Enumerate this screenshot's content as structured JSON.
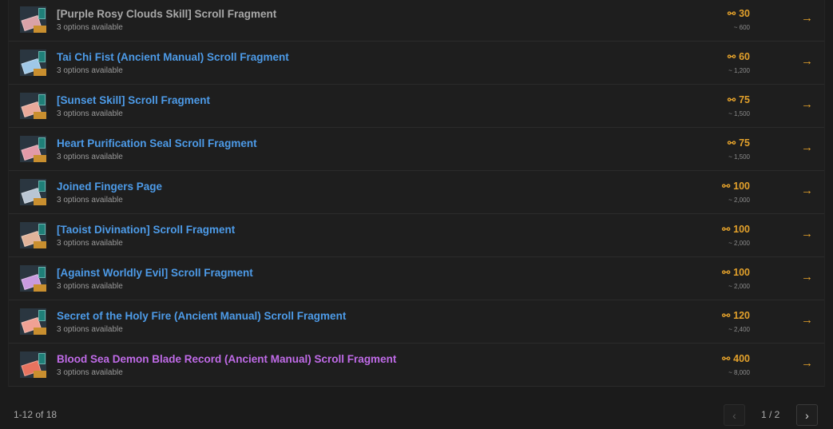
{
  "items": [
    {
      "title": "[Purple Rosy Clouds Skill] Scroll Fragment",
      "subtitle": "3 options available",
      "price": "30",
      "approx": "~ 600",
      "title_color": "#a8a8a8",
      "paper_color": "#d9a2a8"
    },
    {
      "title": "Tai Chi Fist (Ancient Manual) Scroll Fragment",
      "subtitle": "3 options available",
      "price": "60",
      "approx": "~ 1,200",
      "title_color": "#4d9be8",
      "paper_color": "#9fc8e8"
    },
    {
      "title": "[Sunset Skill] Scroll Fragment",
      "subtitle": "3 options available",
      "price": "75",
      "approx": "~ 1,500",
      "title_color": "#4d9be8",
      "paper_color": "#e8a99a"
    },
    {
      "title": "Heart Purification Seal Scroll Fragment",
      "subtitle": "3 options available",
      "price": "75",
      "approx": "~ 1,500",
      "title_color": "#4d9be8",
      "paper_color": "#e29aa8"
    },
    {
      "title": "Joined Fingers Page",
      "subtitle": "3 options available",
      "price": "100",
      "approx": "~ 2,000",
      "title_color": "#4d9be8",
      "paper_color": "#b9c6d4"
    },
    {
      "title": "[Taoist Divination] Scroll Fragment",
      "subtitle": "3 options available",
      "price": "100",
      "approx": "~ 2,000",
      "title_color": "#4d9be8",
      "paper_color": "#e0b39a"
    },
    {
      "title": "[Against Worldly Evil] Scroll Fragment",
      "subtitle": "3 options available",
      "price": "100",
      "approx": "~ 2,000",
      "title_color": "#4d9be8",
      "paper_color": "#c89adf"
    },
    {
      "title": "Secret of the Holy Fire (Ancient Manual) Scroll Fragment",
      "subtitle": "3 options available",
      "price": "120",
      "approx": "~ 2,400",
      "title_color": "#4d9be8",
      "paper_color": "#f0a194"
    },
    {
      "title": "Blood Sea Demon Blade Record (Ancient Manual) Scroll Fragment",
      "subtitle": "3 options available",
      "price": "400",
      "approx": "~ 8,000",
      "title_color": "#c06be8",
      "paper_color": "#e7735f"
    }
  ],
  "icons": {
    "coin": "coin-icon",
    "arrow": "arrow-right-icon",
    "prev": "chevron-left-icon",
    "next": "chevron-right-icon"
  },
  "pagination": {
    "range": "1-12 of 18",
    "page": "1 / 2"
  },
  "colors": {
    "accent": "#e3a12b",
    "background": "#1b1b1b"
  }
}
